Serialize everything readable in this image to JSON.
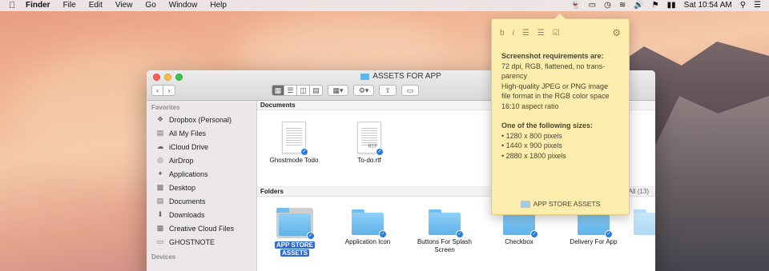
{
  "menubar": {
    "app_name": "Finder",
    "items": [
      "File",
      "Edit",
      "View",
      "Go",
      "Window",
      "Help"
    ],
    "battery_icon": "battery-icon",
    "clock": "Sat 10:54 AM"
  },
  "window": {
    "title": "ASSETS FOR APP",
    "sidebar": {
      "favorites_heading": "Favorites",
      "items": [
        {
          "label": "Dropbox (Personal)",
          "icon": "dropbox-icon"
        },
        {
          "label": "All My Files",
          "icon": "files-icon"
        },
        {
          "label": "iCloud Drive",
          "icon": "cloud-icon"
        },
        {
          "label": "AirDrop",
          "icon": "airdrop-icon"
        },
        {
          "label": "Applications",
          "icon": "applications-icon"
        },
        {
          "label": "Desktop",
          "icon": "desktop-icon"
        },
        {
          "label": "Documents",
          "icon": "documents-icon"
        },
        {
          "label": "Downloads",
          "icon": "downloads-icon"
        },
        {
          "label": "Creative Cloud Files",
          "icon": "creative-cloud-icon"
        },
        {
          "label": "GHOSTNOTE",
          "icon": "drive-icon"
        }
      ],
      "devices_heading": "Devices"
    },
    "documents_heading": "Documents",
    "documents": [
      {
        "name": "Ghostmode Todo",
        "type": ""
      },
      {
        "name": "To-do.rtf",
        "type": "RTF"
      }
    ],
    "folders_heading": "Folders",
    "folders_show_all": "All (13)",
    "folders": [
      {
        "name_line1": "APP STORE",
        "name_line2": "ASSETS",
        "selected": true
      },
      {
        "name_line1": "Application Icon",
        "name_line2": "",
        "selected": false
      },
      {
        "name_line1": "Buttons For Splash",
        "name_line2": "Screen",
        "selected": false
      },
      {
        "name_line1": "Checkbox",
        "name_line2": "",
        "selected": false
      },
      {
        "name_line1": "Delivery For App",
        "name_line2": "",
        "selected": false
      }
    ]
  },
  "note": {
    "tools": {
      "bold": "b",
      "italic": "i"
    },
    "heading1": "Screenshot requirements are:",
    "lines1": [
      "72 dpi, RGB, flattened, no trans-",
      "parency",
      "High-quality JPEG or PNG image",
      "file format in the RGB color space",
      "16:10 aspect ratio"
    ],
    "heading2": "One of the following sizes:",
    "sizes": [
      "1280 x 800 pixels",
      "1440 x 900 pixels",
      "2880 x 1800 pixels"
    ],
    "footer_folder": "APP STORE ASSETS"
  }
}
